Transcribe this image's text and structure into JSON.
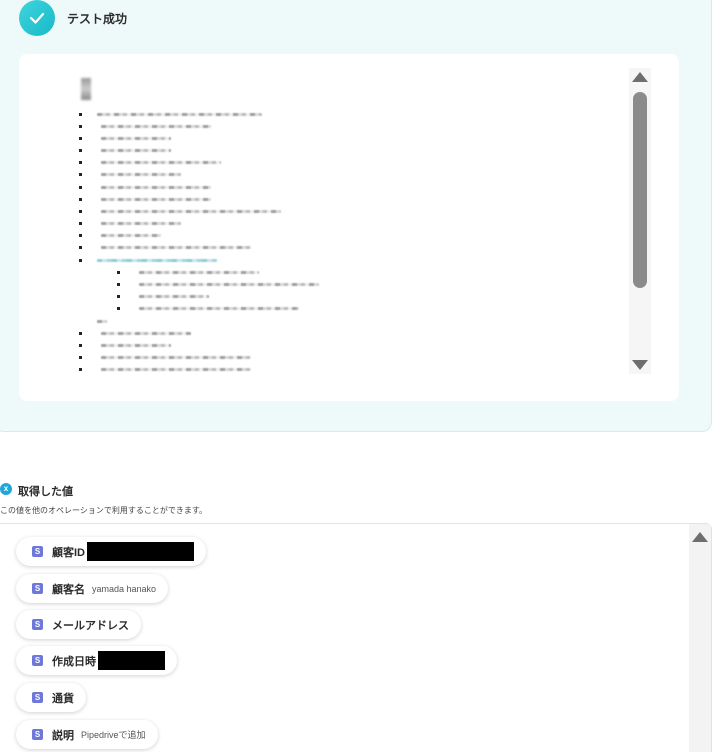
{
  "result": {
    "status_title": "テスト成功",
    "icon": "checkmark-icon",
    "accent_color": "#1fc3cf"
  },
  "values_section": {
    "icon": "variable-icon",
    "title": "取得した値",
    "description": "この値を他のオペレーションで利用することができます。"
  },
  "fields": [
    {
      "badge": "S",
      "label": "顧客ID",
      "value": "",
      "redacted": true
    },
    {
      "badge": "S",
      "label": "顧客名",
      "value": "yamada hanako",
      "redacted": false
    },
    {
      "badge": "S",
      "label": "メールアドレス",
      "value": "",
      "redacted": false
    },
    {
      "badge": "S",
      "label": "作成日時",
      "value": "",
      "redacted": true
    },
    {
      "badge": "S",
      "label": "通貨",
      "value": "",
      "redacted": false
    },
    {
      "badge": "S",
      "label": "説明",
      "value": "Pipedriveで追加",
      "redacted": false
    }
  ]
}
